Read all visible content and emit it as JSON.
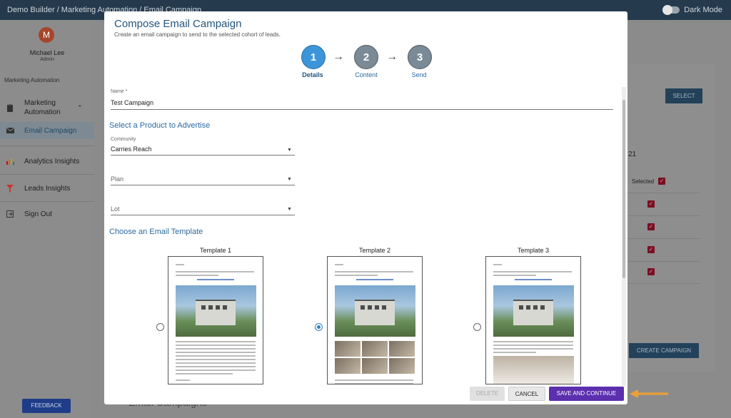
{
  "topbar": {
    "breadcrumb": "Demo Builder / Marketing Automation / Email Campaign",
    "dark_mode_label": "Dark Mode"
  },
  "user": {
    "initial": "M",
    "name": "Michael Lee",
    "role": "Admin"
  },
  "sidebar": {
    "section_label": "Marketing Automation",
    "items": [
      {
        "label": "Marketing Automation",
        "icon": "clipboard-icon"
      },
      {
        "label": "Email Campaign",
        "icon": "mail-icon"
      },
      {
        "label": "Analytics Insights",
        "icon": "bar-chart-icon"
      },
      {
        "label": "Leads Insights",
        "icon": "funnel-icon"
      },
      {
        "label": "Sign Out",
        "icon": "logout-icon"
      }
    ],
    "feedback_label": "FEEDBACK"
  },
  "background": {
    "select_label": "SELECT",
    "number_fragment": "21",
    "selected_label": "Selected",
    "create_campaign_label": "CREATE CAMPAIGN",
    "email_campaigns_label": "Email Campaigns"
  },
  "modal": {
    "title": "Compose Email Campaign",
    "subtitle": "Create an email campaign to send to the selected cohort of leads.",
    "steps": [
      {
        "number": "1",
        "label": "Details"
      },
      {
        "number": "2",
        "label": "Content"
      },
      {
        "number": "3",
        "label": "Send"
      }
    ],
    "name_label": "Name *",
    "name_value": "Test Campaign",
    "product_heading": "Select a Product to Advertise",
    "community_label": "Community",
    "community_value": "Carries Reach",
    "plan_placeholder": "Plan",
    "lot_placeholder": "Lot",
    "template_heading": "Choose an Email Template",
    "templates": [
      {
        "title": "Template 1",
        "selected": false
      },
      {
        "title": "Template 2",
        "selected": true
      },
      {
        "title": "Template 3",
        "selected": false
      }
    ],
    "buttons": {
      "delete": "DELETE",
      "cancel": "CANCEL",
      "save": "SAVE AND CONTINUE"
    }
  },
  "colors": {
    "accent": "#3c95d8",
    "primary_button": "#5b2fae",
    "pointer": "#f0a030",
    "header": "#253a4d"
  }
}
